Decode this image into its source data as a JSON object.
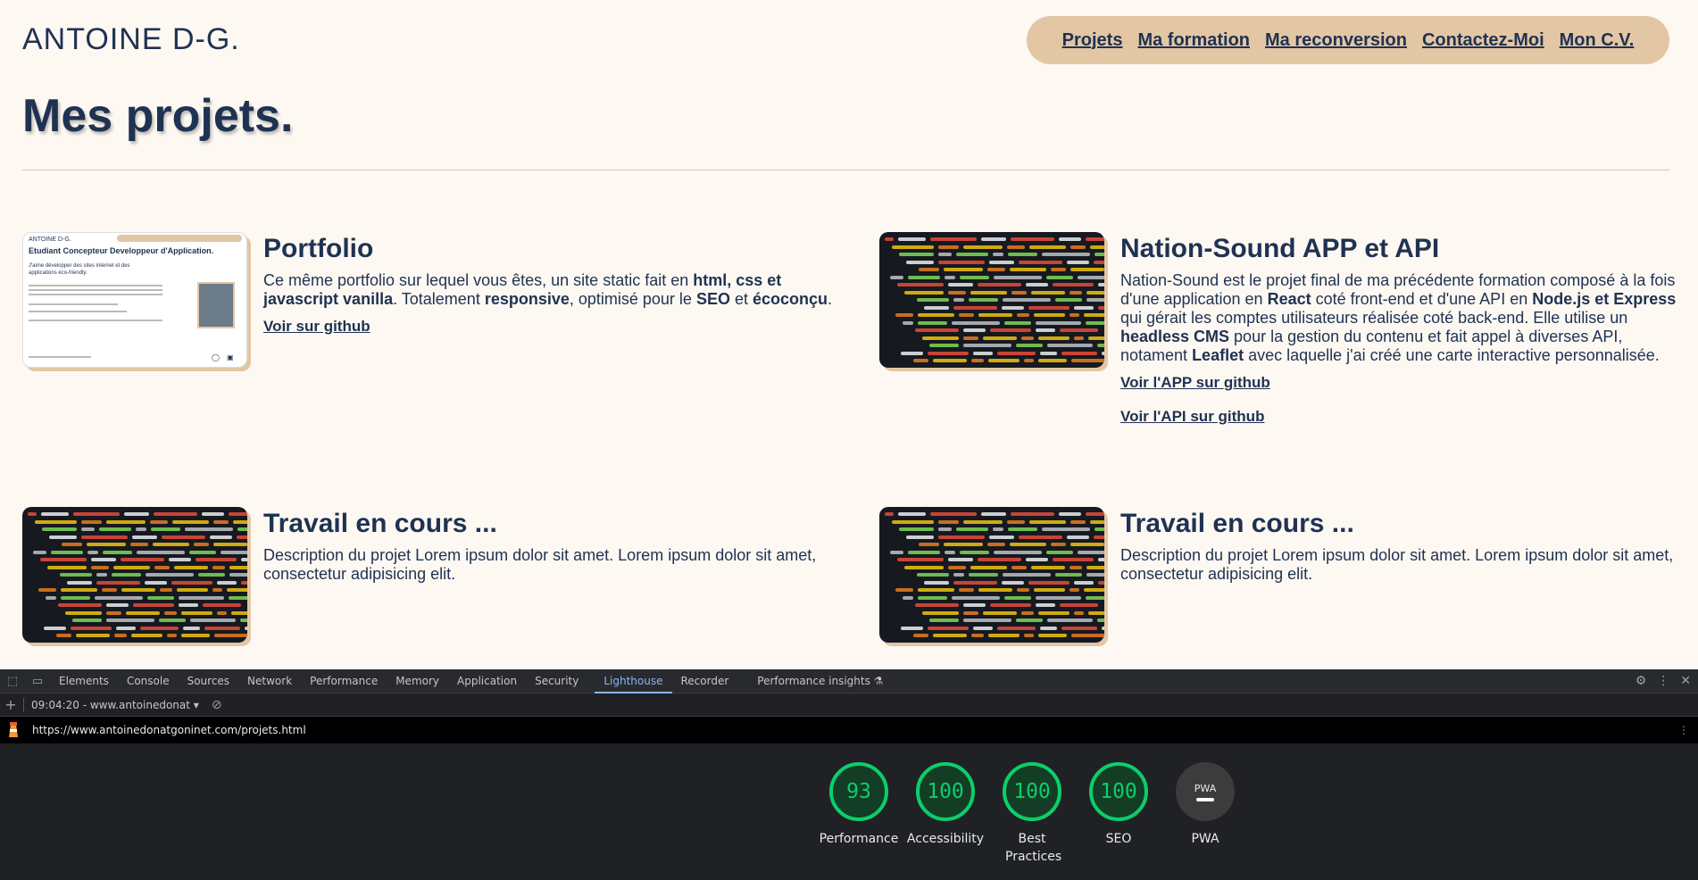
{
  "site": {
    "brand": "ANTOINE D-G.",
    "nav": [
      "Projets",
      "Ma formation",
      "Ma reconversion",
      "Contactez-Moi",
      "Mon C.V."
    ],
    "page_title": "Mes projets."
  },
  "projects": [
    {
      "title": "Portfolio",
      "desc_parts": [
        {
          "t": "Ce même portfolio sur lequel vous êtes, un site static fait en ",
          "b": false
        },
        {
          "t": "html, css et javascript vanilla",
          "b": true
        },
        {
          "t": ". Totalement ",
          "b": false
        },
        {
          "t": "responsive",
          "b": true
        },
        {
          "t": ", optimisé pour le ",
          "b": false
        },
        {
          "t": "SEO",
          "b": true
        },
        {
          "t": " et ",
          "b": false
        },
        {
          "t": "écoconçu",
          "b": true
        },
        {
          "t": ".",
          "b": false
        }
      ],
      "links": [
        "Voir sur github"
      ],
      "thumb": {
        "brand": "ANTOINE D-G.",
        "headline": "Etudiant Concepteur Developpeur d'Application.",
        "tagline": "J'aime développer des sites internet et des applications éco-friendly."
      }
    },
    {
      "title": "Nation-Sound APP et API",
      "desc_parts": [
        {
          "t": "Nation-Sound est le projet final de ma précédente formation composé à la fois d'une application en ",
          "b": false
        },
        {
          "t": "React",
          "b": true
        },
        {
          "t": " coté front-end et d'une API en ",
          "b": false
        },
        {
          "t": "Node.js et Express",
          "b": true
        },
        {
          "t": " qui gérait les comptes utilisateurs réalisée coté back-end. Elle utilise un ",
          "b": false
        },
        {
          "t": "headless CMS",
          "b": true
        },
        {
          "t": " pour la gestion du contenu et fait appel à diverses API, notament ",
          "b": false
        },
        {
          "t": "Leaflet",
          "b": true
        },
        {
          "t": " avec laquelle j'ai créé une carte interactive personnalisée.",
          "b": false
        }
      ],
      "links": [
        "Voir l'APP sur github",
        "Voir l'API sur github"
      ]
    },
    {
      "title": "Travail en cours ...",
      "desc_parts": [
        {
          "t": "Description du projet Lorem ipsum dolor sit amet. Lorem ipsum dolor sit amet, consectetur adipisicing elit.",
          "b": false
        }
      ],
      "links": []
    },
    {
      "title": "Travail en cours ...",
      "desc_parts": [
        {
          "t": "Description du projet Lorem ipsum dolor sit amet. Lorem ipsum dolor sit amet, consectetur adipisicing elit.",
          "b": false
        }
      ],
      "links": []
    }
  ],
  "devtools": {
    "tabs": [
      "Elements",
      "Console",
      "Sources",
      "Network",
      "Performance",
      "Memory",
      "Application",
      "Security",
      "Lighthouse",
      "Recorder",
      "Performance insights"
    ],
    "active_tab": "Lighthouse",
    "report_selector": "09:04:20 - www.antoinedonat",
    "url": "https://www.antoinedonatgoninet.com/projets.html",
    "scores": [
      {
        "label": "Performance",
        "value": "93"
      },
      {
        "label": "Accessibility",
        "value": "100"
      },
      {
        "label": "Best Practices",
        "value": "100"
      },
      {
        "label": "SEO",
        "value": "100"
      },
      {
        "label": "PWA",
        "value": "PWA"
      }
    ],
    "colors": {
      "pass": "#0cce6b",
      "active_tab": "#8ab4f8"
    }
  }
}
